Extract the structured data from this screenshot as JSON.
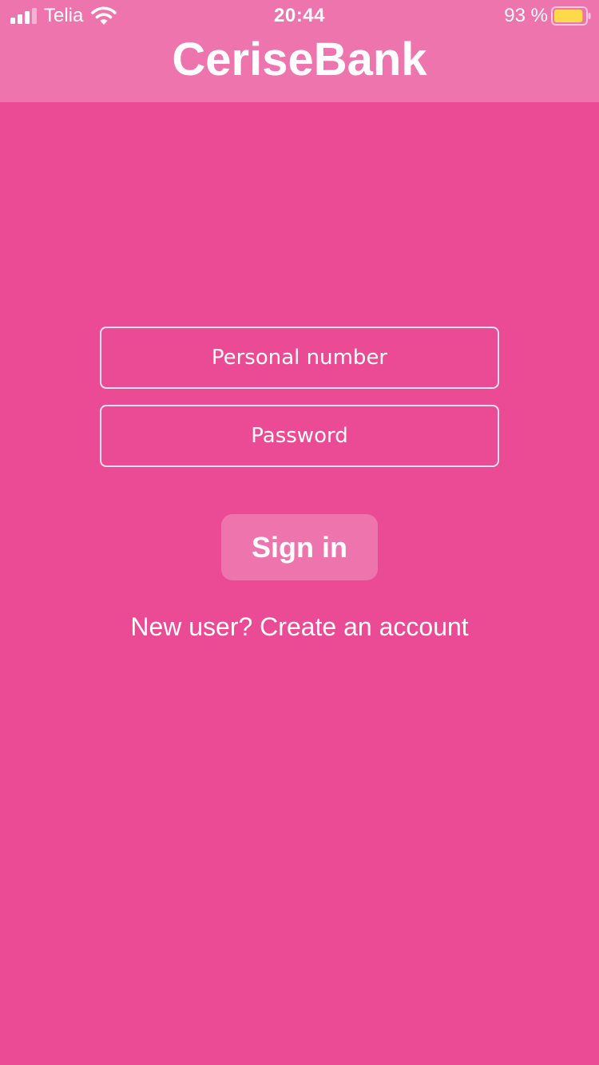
{
  "status_bar": {
    "carrier": "Telia",
    "time": "20:44",
    "battery_percent": "93 %",
    "signal_icon": "cellular-signal-icon",
    "wifi_icon": "wifi-icon",
    "battery_icon": "battery-icon",
    "battery_level": 0.93
  },
  "header": {
    "title": "CeriseBank"
  },
  "login_form": {
    "personal_number": {
      "placeholder": "Personal number",
      "value": ""
    },
    "password": {
      "placeholder": "Password",
      "value": ""
    },
    "sign_in_label": "Sign in",
    "create_account_label": "New user? Create an account"
  },
  "colors": {
    "background": "#EB4A95",
    "header_background": "#EE74AE",
    "button_background": "#EE74AE",
    "text": "#FFFFFF",
    "battery_fill": "#FFD94A"
  }
}
